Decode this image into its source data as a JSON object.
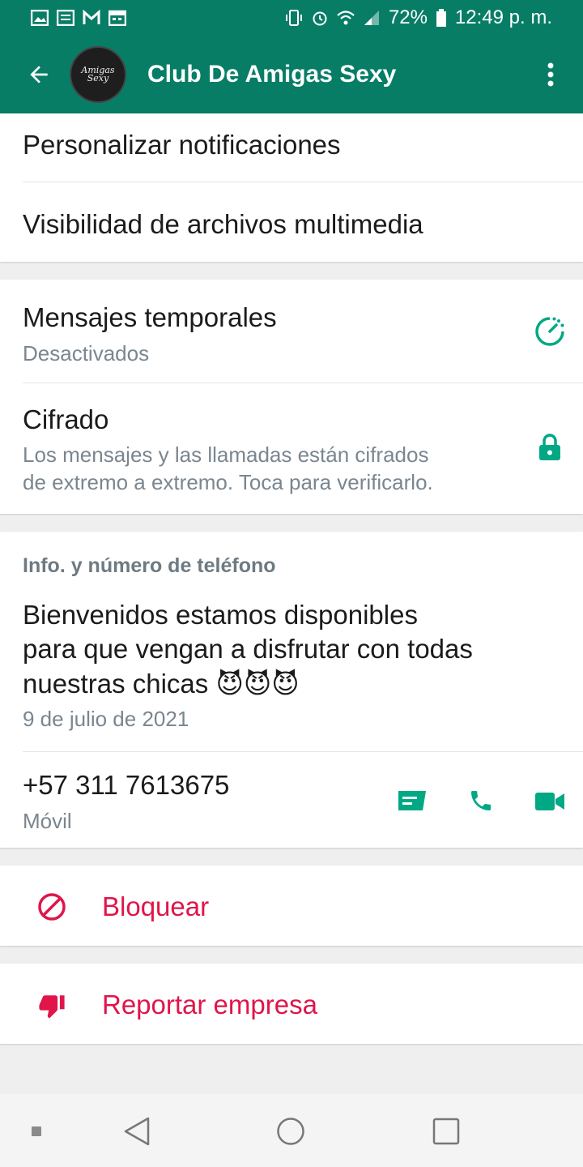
{
  "status_bar": {
    "battery": "72%",
    "time": "12:49 p. m."
  },
  "header": {
    "title": "Club De Amigas Sexy",
    "avatar_text": "Amigas Sexy"
  },
  "settings": {
    "custom_notifications": "Personalizar notificaciones",
    "media_visibility": "Visibilidad de archivos multimedia"
  },
  "privacy": {
    "disappearing_title": "Mensajes temporales",
    "disappearing_status": "Desactivados",
    "encryption_title": "Cifrado",
    "encryption_desc_line1": "Los mensajes y las llamadas están cifrados",
    "encryption_desc_line2": "de extremo a extremo. Toca para verificarlo."
  },
  "info": {
    "section_title": "Info. y número de teléfono",
    "about_line1": "Bienvenidos estamos disponibles",
    "about_line2": "para que vengan a disfrutar con todas",
    "about_line3": "nuestras chicas 😈😈😈",
    "about_date": "9 de julio de 2021",
    "phone": "+57 311 7613675",
    "phone_type": "Móvil"
  },
  "actions": {
    "block": "Bloquear",
    "report": "Reportar empresa"
  },
  "colors": {
    "brand": "#077d66",
    "accent": "#00a884",
    "danger": "#e0154a"
  }
}
